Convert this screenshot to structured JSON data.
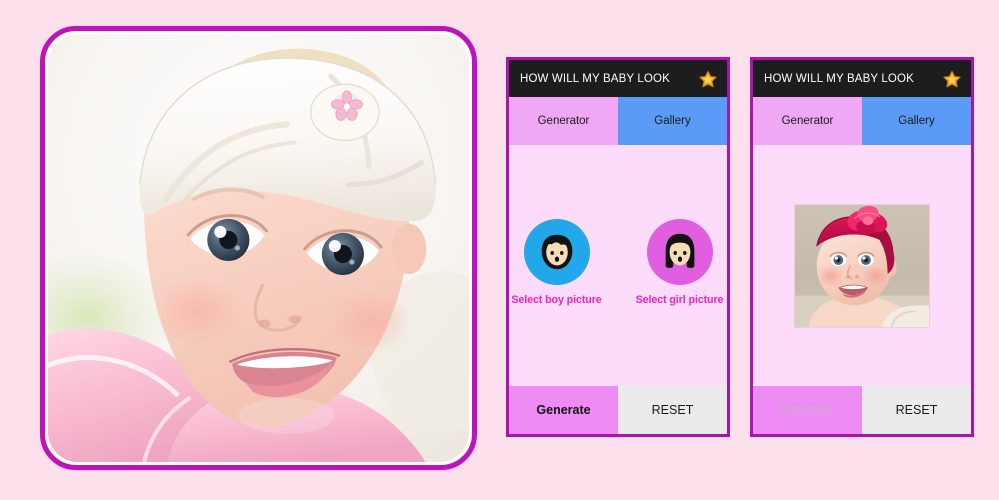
{
  "canvas": {
    "background_color": "#fce0ec",
    "accent_color": "#bd13bd"
  },
  "hero": {
    "name": "baby-hero-photo",
    "alt": "Close-up photo of a smiling blue-eyed baby wearing a white knotted headband with a pink flower pin and a pink outfit",
    "frame_border_color": "#bd13bd",
    "frame_radius": "36px"
  },
  "phones": [
    {
      "id": "phone-generator",
      "appbar": {
        "title": "HOW WILL MY BABY LOOK",
        "star_icon": "star-icon",
        "star_color": "#f5a623",
        "background_color": "#1d1d1d"
      },
      "tabs": [
        {
          "label": "Generator",
          "active": false,
          "color": "#f0a8f5"
        },
        {
          "label": "Gallery",
          "active": true,
          "color": "#5b9bf8"
        }
      ],
      "pickers": [
        {
          "label": "Select boy picture",
          "icon": "boy-avatar-icon",
          "circle_color": "#22a7e8",
          "label_color": "#ef22c7"
        },
        {
          "label": "Select girl picture",
          "icon": "girl-avatar-icon",
          "circle_color": "#e05fe0",
          "label_color": "#ef22c7"
        }
      ],
      "actions": [
        {
          "label": "Generate",
          "style": "primary",
          "disabled": false,
          "color": "#ef8bf5"
        },
        {
          "label": "RESET",
          "style": "secondary",
          "disabled": false,
          "color": "#ebebeb"
        }
      ]
    },
    {
      "id": "phone-gallery",
      "appbar": {
        "title": "HOW WILL MY BABY LOOK",
        "star_icon": "star-icon",
        "star_color": "#f5a623",
        "background_color": "#1d1d1d"
      },
      "tabs": [
        {
          "label": "Generator",
          "active": false,
          "color": "#f0a8f5"
        },
        {
          "label": "Gallery",
          "active": true,
          "color": "#5b9bf8"
        }
      ],
      "preview": {
        "name": "gallery-baby-photo",
        "alt": "Photo of a smiling baby girl wearing a dark pink headband with a large fabric flower"
      },
      "actions": [
        {
          "label": "Generate",
          "style": "primary",
          "disabled": true,
          "color": "#ef8bf5"
        },
        {
          "label": "RESET",
          "style": "secondary",
          "disabled": false,
          "color": "#ebebeb"
        }
      ]
    }
  ]
}
